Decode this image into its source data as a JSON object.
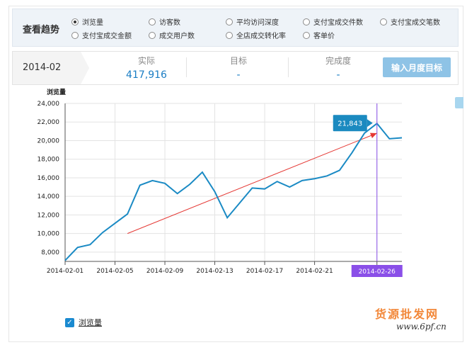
{
  "trend": {
    "title": "查看趋势",
    "options": [
      {
        "label": "浏览量",
        "selected": true
      },
      {
        "label": "访客数",
        "selected": false
      },
      {
        "label": "平均访问深度",
        "selected": false
      },
      {
        "label": "支付宝成交件数",
        "selected": false
      },
      {
        "label": "支付宝成交笔数",
        "selected": false
      },
      {
        "label": "支付宝成交金额",
        "selected": false
      },
      {
        "label": "成交用户数",
        "selected": false
      },
      {
        "label": "全店成交转化率",
        "selected": false
      },
      {
        "label": "客单价",
        "selected": false
      }
    ]
  },
  "summary": {
    "month": "2014-02",
    "actual_label": "实际",
    "actual_value": "417,916",
    "target_label": "目标",
    "target_value": "-",
    "completion_label": "完成度",
    "completion_value": "-",
    "set_target_button": "输入月度目标"
  },
  "chart_data": {
    "type": "line",
    "ylabel": "浏览量",
    "ylim": [
      7000,
      24000
    ],
    "yticks": [
      8000,
      10000,
      12000,
      14000,
      16000,
      18000,
      20000,
      22000,
      24000
    ],
    "xlim": [
      1,
      28
    ],
    "xtick_labels": [
      "2014-02-01",
      "2014-02-05",
      "2014-02-09",
      "2014-02-13",
      "2014-02-17",
      "2014-02-21",
      "2014-02-26"
    ],
    "xtick_days": [
      1,
      5,
      9,
      13,
      17,
      21,
      26
    ],
    "series": [
      {
        "name": "浏览量",
        "color": "#1a8ac4",
        "x": [
          1,
          2,
          3,
          4,
          5,
          6,
          7,
          8,
          9,
          10,
          11,
          12,
          13,
          14,
          15,
          16,
          17,
          18,
          19,
          20,
          21,
          22,
          23,
          24,
          25,
          26,
          27,
          28
        ],
        "values": [
          7100,
          8500,
          8800,
          10100,
          11100,
          12100,
          15200,
          15700,
          15400,
          14300,
          15300,
          16600,
          14500,
          11700,
          13300,
          14900,
          14800,
          15600,
          15000,
          15700,
          15900,
          16200,
          16800,
          18700,
          20800,
          21843,
          20200,
          20300
        ]
      }
    ],
    "trendline": {
      "color": "#e53935",
      "x": [
        6,
        26
      ],
      "values": [
        10000,
        20800
      ]
    },
    "highlight": {
      "x": 26,
      "label": "2014-02-26",
      "value_label": "21,843",
      "color": "#8a4fe8"
    },
    "grid": true
  },
  "legend": {
    "label": "浏览量",
    "checked": true
  },
  "watermark": {
    "line1": "货源批发网",
    "line2": "www.6pf.cn"
  }
}
